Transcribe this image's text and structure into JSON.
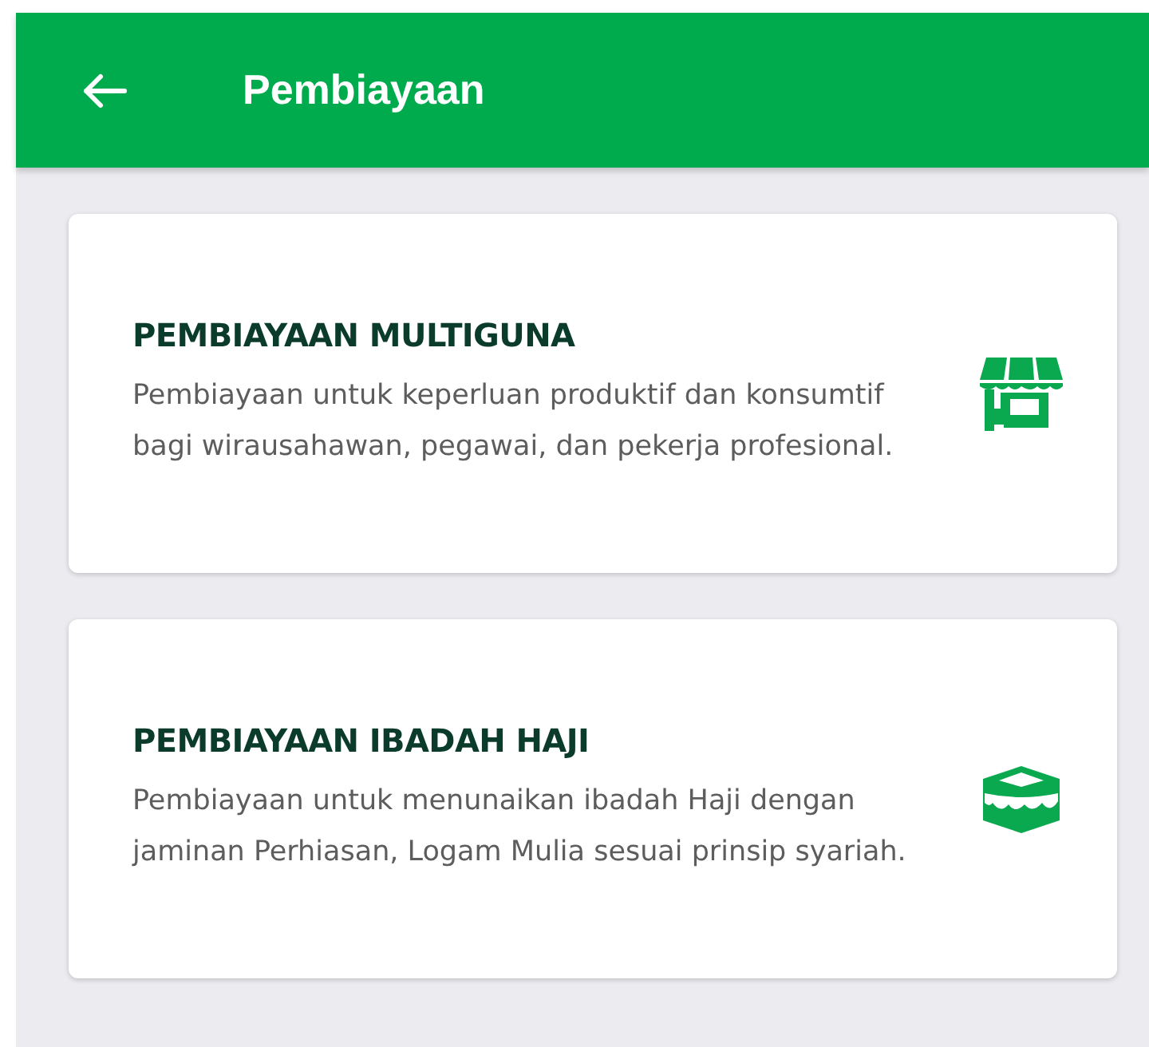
{
  "header": {
    "title": "Pembiayaan"
  },
  "products": [
    {
      "kind": "store",
      "title": "PEMBIAYAAN MULTIGUNA",
      "description": "Pembiayaan untuk keperluan produktif dan konsumtif bagi wirausahawan, pegawai, dan pekerja profesional."
    },
    {
      "kind": "kaaba",
      "title": "PEMBIAYAAN IBADAH HAJI",
      "description": "Pembiayaan untuk menunaikan ibadah Haji dengan jaminan Perhiasan, Logam Mulia sesuai prinsip syariah."
    }
  ]
}
